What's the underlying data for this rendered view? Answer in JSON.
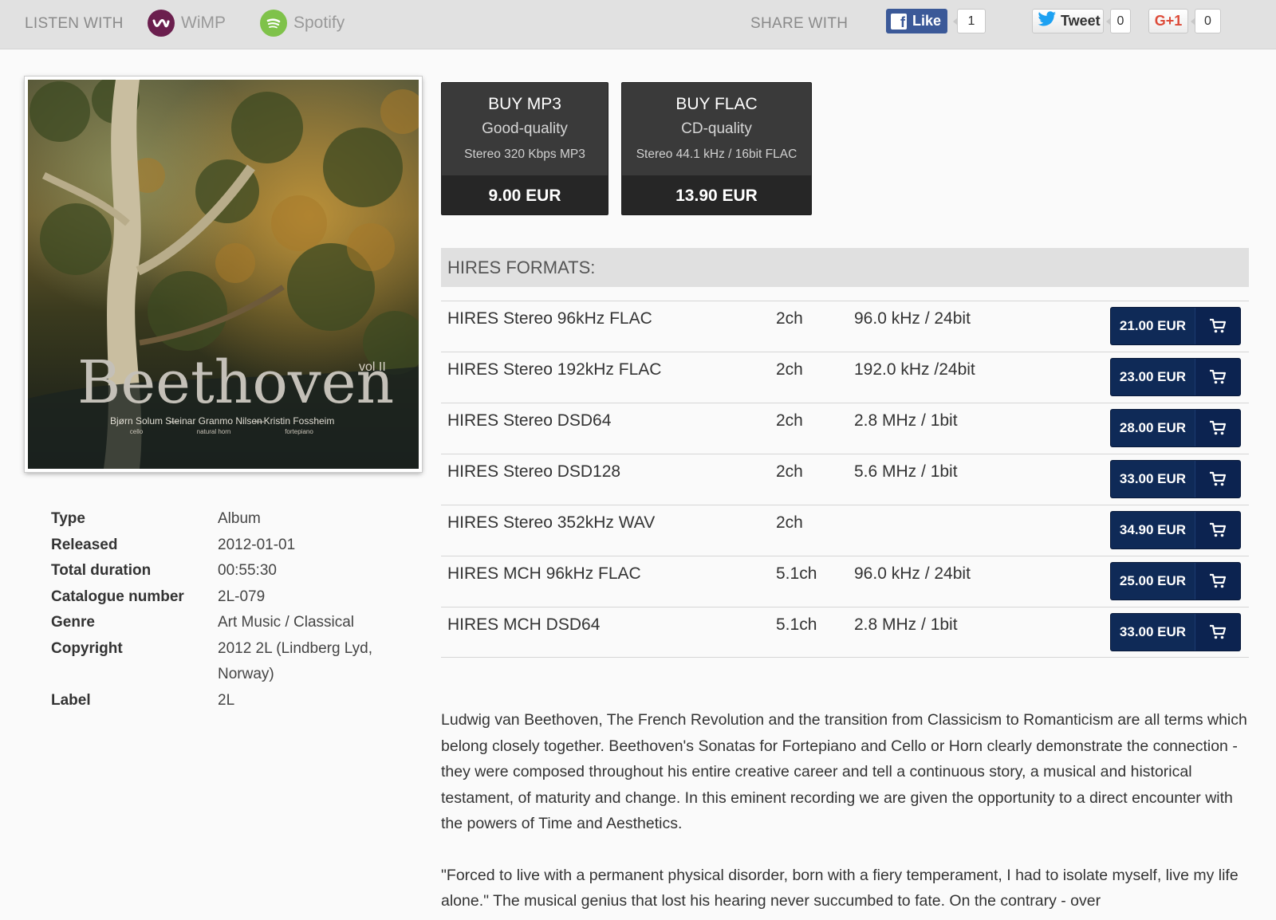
{
  "topbar": {
    "listen_label": "LISTEN WITH",
    "services": [
      {
        "name": "WiMP",
        "icon": "wimp-icon"
      },
      {
        "name": "Spotify",
        "icon": "spotify-icon"
      }
    ],
    "share_label": "SHARE WITH",
    "facebook": {
      "label": "Like",
      "count": "1"
    },
    "twitter": {
      "label": "Tweet",
      "count": "0"
    },
    "gplus": {
      "label": "G+1",
      "count": "0"
    }
  },
  "album": {
    "cover_title": "Beethoven",
    "cover_volume": "vol II",
    "performers": [
      {
        "name": "Bjørn Solum",
        "role": "cello"
      },
      {
        "name": "Steinar Granmo Nilsen",
        "role": "natural horn"
      },
      {
        "name": "Kristin Fossheim",
        "role": "fortepiano"
      }
    ]
  },
  "info": [
    {
      "key": "Type",
      "value": "Album"
    },
    {
      "key": "Released",
      "value": "2012-01-01"
    },
    {
      "key": "Total duration",
      "value": "00:55:30"
    },
    {
      "key": "Catalogue number",
      "value": "2L-079"
    },
    {
      "key": "Genre",
      "value": "Art Music / Classical"
    },
    {
      "key": "Copyright",
      "value": "2012 2L (Lindberg Lyd, Norway)"
    },
    {
      "key": "Label",
      "value": "2L"
    }
  ],
  "buy": {
    "mp3": {
      "title": "BUY MP3",
      "quality": "Good-quality",
      "spec": "Stereo 320 Kbps MP3",
      "price": "9.00 EUR"
    },
    "flac": {
      "title": "BUY FLAC",
      "quality": "CD-quality",
      "spec": "Stereo 44.1 kHz / 16bit FLAC",
      "price": "13.90 EUR"
    }
  },
  "hires": {
    "heading": "HIRES FORMATS:",
    "rows": [
      {
        "name": "HIRES Stereo 96kHz FLAC",
        "channels": "2ch",
        "rate": "96.0 kHz / 24bit",
        "price": "21.00 EUR"
      },
      {
        "name": "HIRES Stereo 192kHz FLAC",
        "channels": "2ch",
        "rate": "192.0 kHz /24bit",
        "price": "23.00 EUR"
      },
      {
        "name": "HIRES Stereo DSD64",
        "channels": "2ch",
        "rate": "2.8 MHz / 1bit",
        "price": "28.00 EUR"
      },
      {
        "name": "HIRES Stereo DSD128",
        "channels": "2ch",
        "rate": "5.6 MHz / 1bit",
        "price": "33.00 EUR"
      },
      {
        "name": "HIRES Stereo 352kHz WAV",
        "channels": "2ch",
        "rate": "",
        "price": "34.90 EUR"
      },
      {
        "name": "HIRES MCH 96kHz FLAC",
        "channels": "5.1ch",
        "rate": "96.0 kHz / 24bit",
        "price": "25.00 EUR"
      },
      {
        "name": "HIRES MCH DSD64",
        "channels": "5.1ch",
        "rate": "2.8 MHz / 1bit",
        "price": "33.00 EUR"
      }
    ]
  },
  "description": {
    "paragraphs": [
      "Ludwig van Beethoven, The French Revolution and the transition from Classicism to Romanticism are all terms which belong closely together. Beethoven's Sonatas for Fortepiano and Cello or Horn clearly demonstrate the connection - they were composed throughout his entire creative career and tell a continuous story, a musical and historical testament, of maturity and change. In this eminent recording we are given the opportunity to a direct encounter with the powers of Time and Aesthetics.",
      "\"Forced to live with a permanent physical disorder, born with a fiery temperament, I had to isolate myself, live my life alone.\" The musical genius that lost his hearing never succumbed to fate. On the contrary - over"
    ]
  },
  "colors": {
    "topbar_bg": "#e1e1e1",
    "buy_box_bg": "#3a3a3a",
    "cart_button_bg": "#0f2a57",
    "facebook_blue": "#3b5998",
    "gplus_red": "#dd4b39",
    "spotify_green": "#7fc24a",
    "wimp_purple": "#6b1f4e"
  }
}
